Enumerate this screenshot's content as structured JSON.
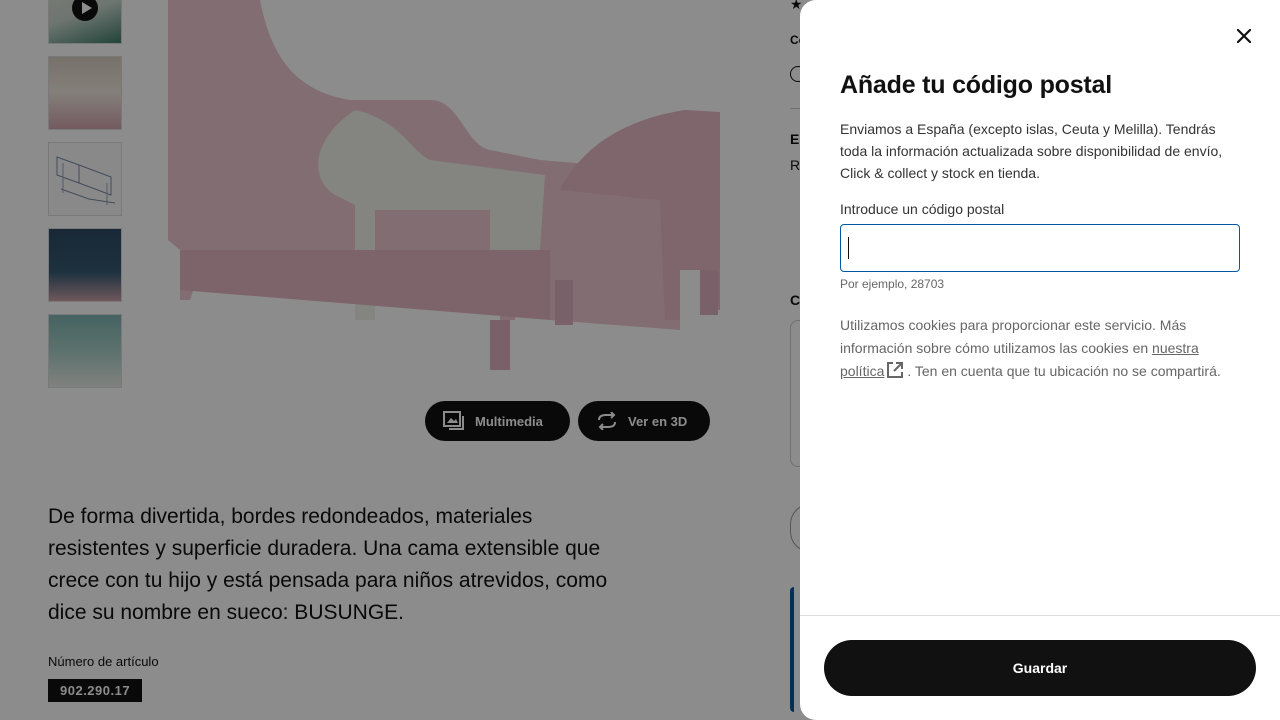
{
  "product": {
    "media_button_label": "Multimedia",
    "view3d_button_label": "Ver en 3D",
    "description": "De forma divertida, bordes redondeados, materiales resistentes y superficie duradera. Una cama extensible que crece con tu hijo y está pensada para niños atrevidos, como dice su nombre en sueco: BUSUNGE.",
    "article_number_label": "Número de artículo",
    "article_number": "902.290.17",
    "bed_color": "#ecc6d0"
  },
  "right_column": {
    "fragments": [
      "Co",
      "El",
      "R",
      "C"
    ]
  },
  "modal": {
    "title": "Añade tu código postal",
    "description": "Enviamos a España (excepto islas, Ceuta y Melilla). Tendrás toda la información actualizada sobre disponibilidad de envío, Click & collect y stock en tienda.",
    "postal_label": "Introduce un código postal",
    "postal_value": "",
    "postal_hint": "Por ejemplo, 28703",
    "cookie_text_before": "Utilizamos cookies para proporcionar este servicio. Más información sobre cómo utilizamos las cookies en ",
    "policy_link": "nuestra política",
    "cookie_text_after": ". Ten en cuenta que tu ubicación no se compartirá.",
    "save_label": "Guardar"
  },
  "colors": {
    "input_focus": "#0058a3",
    "button_dark": "#111111",
    "overlay": "rgba(0,0,0,0.45)"
  }
}
